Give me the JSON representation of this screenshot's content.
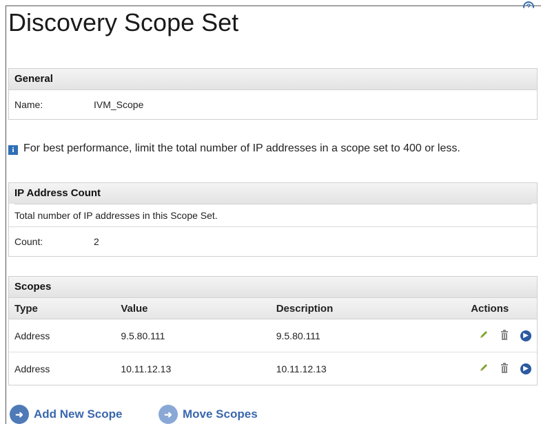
{
  "page": {
    "title": "Discovery Scope Set"
  },
  "general": {
    "header": "General",
    "name_label": "Name:",
    "name_value": "IVM_Scope"
  },
  "info": {
    "message": "For best performance, limit the total number of IP addresses in a scope set to 400 or less."
  },
  "ip_address_count": {
    "header": "IP Address Count",
    "description": "Total number of IP addresses in this Scope Set.",
    "count_label": "Count:",
    "count_value": "2"
  },
  "scopes": {
    "header": "Scopes",
    "columns": {
      "type": "Type",
      "value": "Value",
      "description": "Description",
      "actions": "Actions"
    },
    "rows": [
      {
        "type": "Address",
        "value": "9.5.80.111",
        "description": "9.5.80.111"
      },
      {
        "type": "Address",
        "value": "10.11.12.13",
        "description": "10.11.12.13"
      }
    ]
  },
  "actions": {
    "add_new_scope": "Add New Scope",
    "move_scopes": "Move Scopes"
  },
  "colors": {
    "accent": "#2b5aa0",
    "info": "#2f6fb6",
    "edit": "#7aa52a",
    "delete": "#888888"
  },
  "icons": {
    "help": "help-icon",
    "info": "info-icon",
    "edit": "pencil-icon",
    "delete": "trash-icon",
    "go": "arrow-right-circle-icon"
  }
}
